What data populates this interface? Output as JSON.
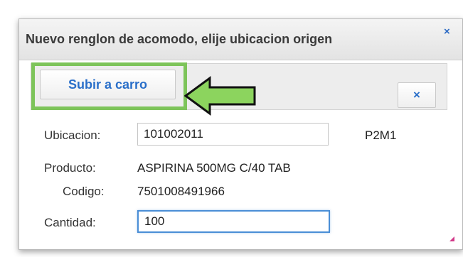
{
  "dialog": {
    "title": "Nuevo renglon de acomodo, elije ubicacion origen",
    "close_glyph": "×",
    "close_icon": "close-icon"
  },
  "toolbar": {
    "subir_label": "Subir a carro",
    "close_glyph": "×",
    "close_icon": "close-icon"
  },
  "annotation": {
    "arrow_icon": "green-arrow-left-icon",
    "highlight_color": "#7dc45a"
  },
  "form": {
    "ubicacion_label": "Ubicacion:",
    "ubicacion_value": "101002011",
    "location_code": "P2M1",
    "producto_label": "Producto:",
    "producto_value": "ASPIRINA 500MG C/40 TAB",
    "codigo_label": "Codigo:",
    "codigo_value": "7501008491966",
    "cantidad_label": "Cantidad:",
    "cantidad_value": "100"
  },
  "colors": {
    "accent": "#2a6fc9",
    "focus": "#4a8ed6"
  }
}
